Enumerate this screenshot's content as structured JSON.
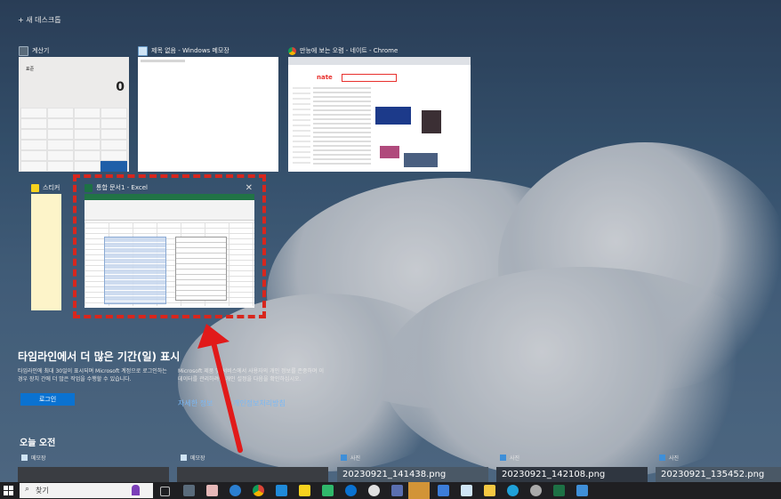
{
  "new_desktop": "+ 새 데스크톱",
  "windows": {
    "calculator": {
      "title": "계산기",
      "mode": "표준",
      "display": "0"
    },
    "notepad": {
      "title": "제목 없음 - Windows 메모장"
    },
    "chrome": {
      "title": "만능에 보는 오렴 - 네이트 - Chrome",
      "logo": "nate"
    },
    "sticky": {
      "title": "스티커 메모"
    },
    "excel": {
      "title": "통합 문서1 - Excel"
    }
  },
  "timeline": {
    "title": "타임라인에서 더 많은 기간(일) 표시",
    "desc": "타임라인에 최대 30일이 표시되며 Microsoft 계정으로 로그인하는 경우 장치 간에 더 많은 작업을 수행할 수 있습니다.",
    "login": "로그인",
    "privacy": "Microsoft 제품 및 서비스에서 사용자의 개인 정보를 존중하며 이 데이터를 관리하려면 개인 설정을 다음을 확인하십시오.",
    "more_info": "자세한 정보",
    "privacy_link": "개인정보처리방침"
  },
  "today": {
    "title": "오늘 오전",
    "cards": [
      {
        "app": "메모장",
        "name": ""
      },
      {
        "app": "메모장",
        "name": ""
      },
      {
        "app": "사진",
        "name": "20230921_141438.png"
      },
      {
        "app": "사진",
        "name": "20230921_142108.png"
      },
      {
        "app": "사진",
        "name": "20230921_135452.png"
      }
    ]
  },
  "taskbar": {
    "search": "찾기"
  },
  "colors": {
    "accent": "#0a72d1",
    "selection": "#d8261d",
    "taskbar": "#1f1f22"
  }
}
